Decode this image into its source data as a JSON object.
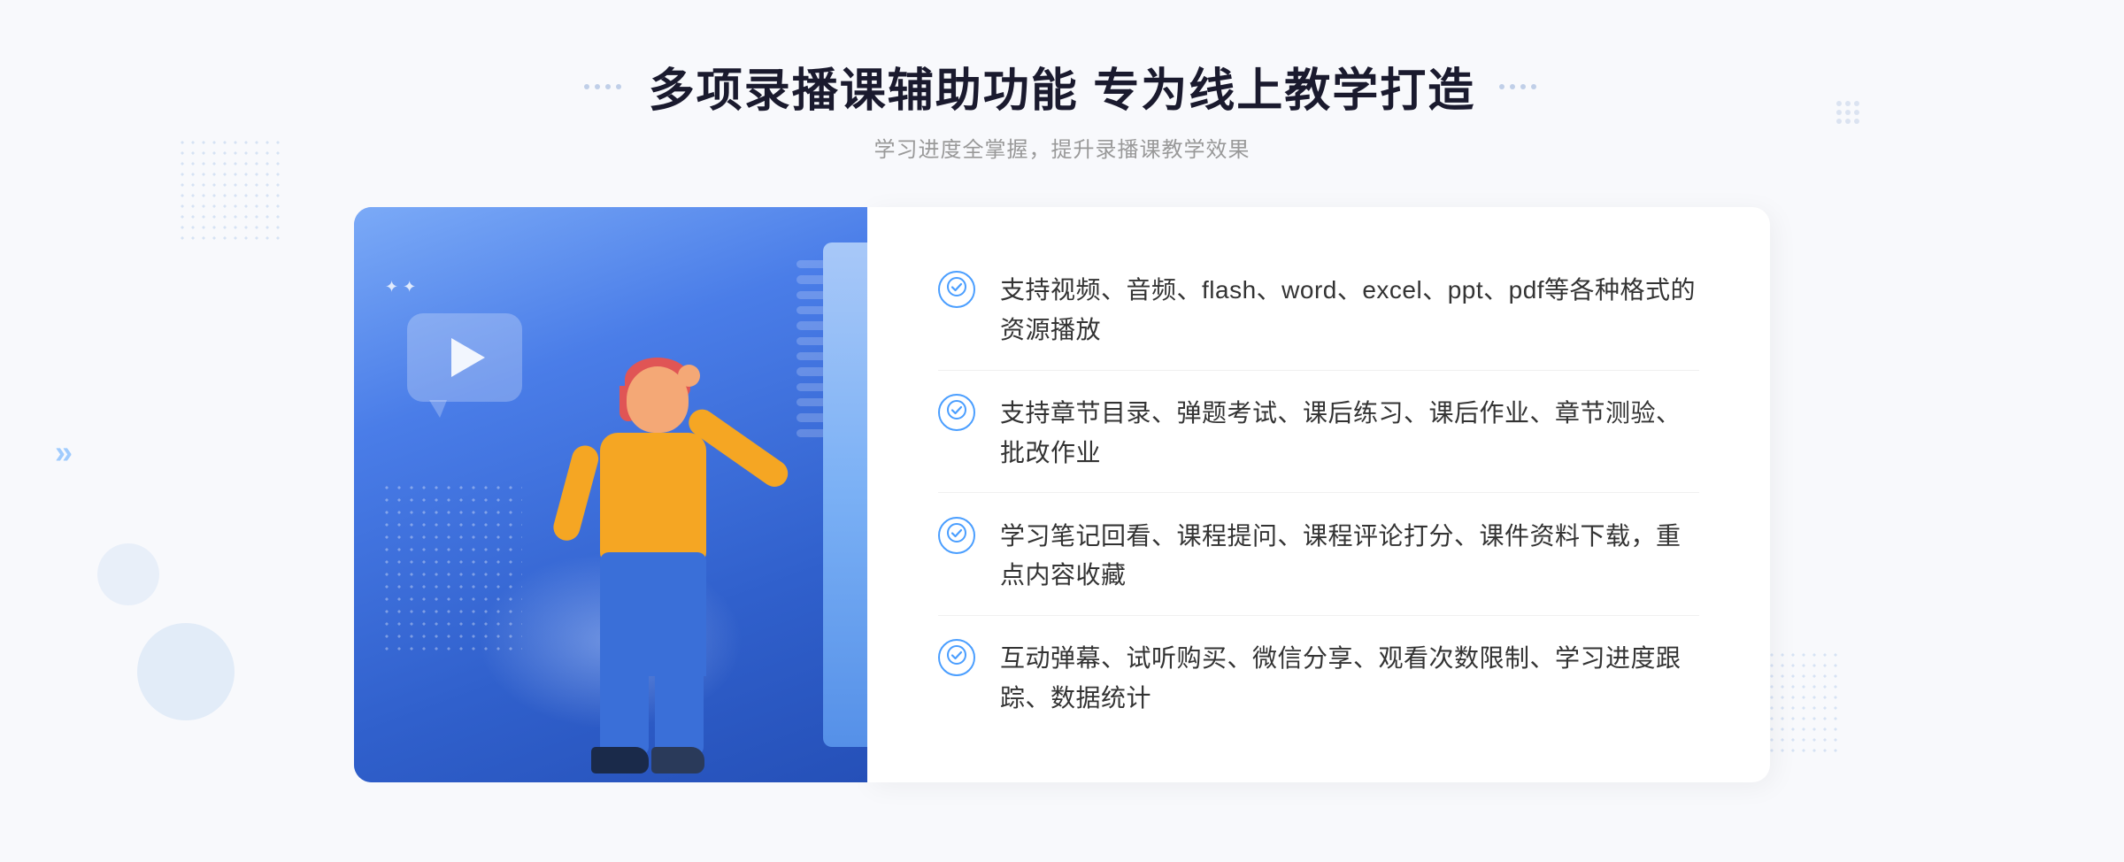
{
  "header": {
    "title": "多项录播课辅助功能 专为线上教学打造",
    "subtitle": "学习进度全掌握，提升录播课教学效果"
  },
  "features": [
    {
      "id": "feature-1",
      "text": "支持视频、音频、flash、word、excel、ppt、pdf等各种格式的资源播放"
    },
    {
      "id": "feature-2",
      "text": "支持章节目录、弹题考试、课后练习、课后作业、章节测验、批改作业"
    },
    {
      "id": "feature-3",
      "text": "学习笔记回看、课程提问、课程评论打分、课件资料下载，重点内容收藏"
    },
    {
      "id": "feature-4",
      "text": "互动弹幕、试听购买、微信分享、观看次数限制、学习进度跟踪、数据统计"
    }
  ],
  "decorations": {
    "chevron_left": "»",
    "chevron_right": "::"
  }
}
